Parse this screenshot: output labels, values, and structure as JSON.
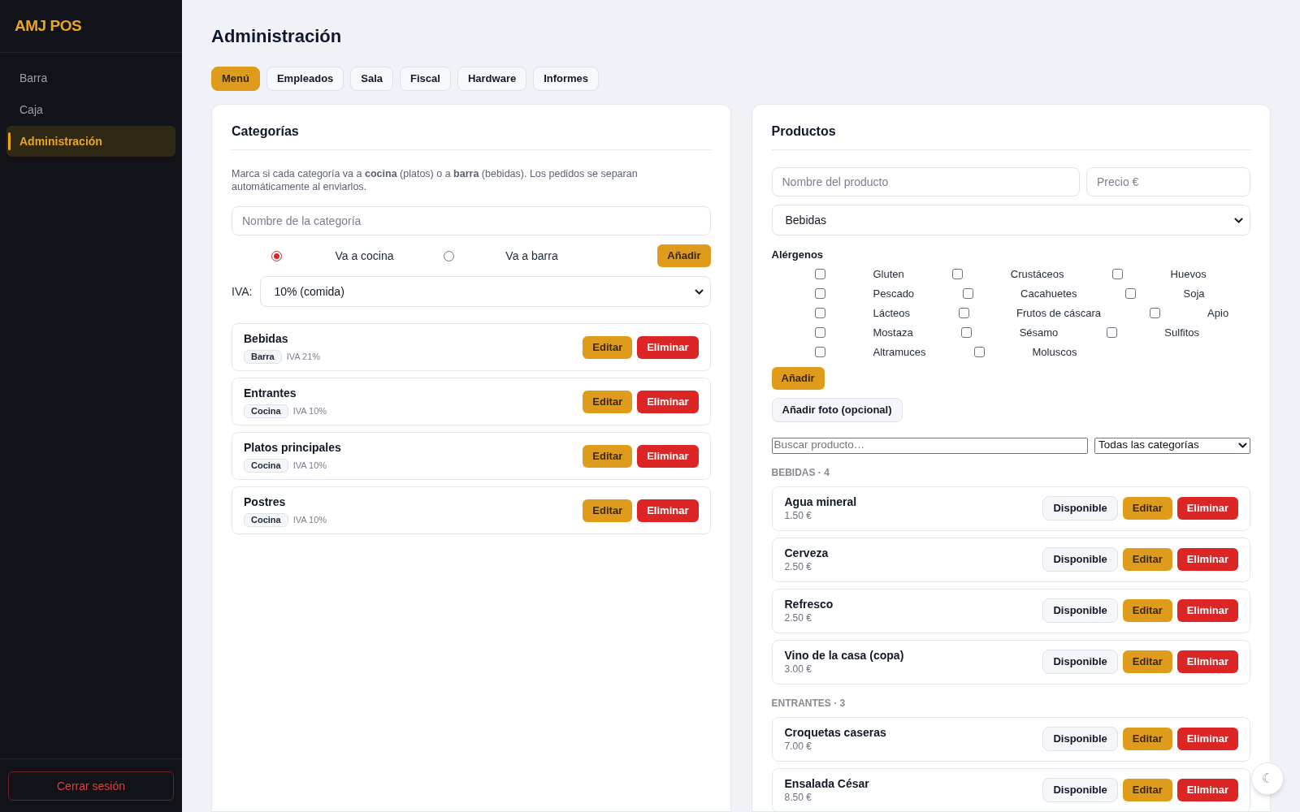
{
  "sidebar": {
    "logo": "AMJ POS",
    "items": [
      {
        "label": "Barra",
        "selected": false
      },
      {
        "label": "Caja",
        "selected": false
      },
      {
        "label": "Administración",
        "selected": true
      }
    ],
    "logout": "Cerrar sesión"
  },
  "page": {
    "title": "Administración"
  },
  "tabs": [
    {
      "label": "Menú",
      "selected": true
    },
    {
      "label": "Empleados",
      "selected": false
    },
    {
      "label": "Sala",
      "selected": false
    },
    {
      "label": "Fiscal",
      "selected": false
    },
    {
      "label": "Hardware",
      "selected": false
    },
    {
      "label": "Informes",
      "selected": false
    }
  ],
  "categories": {
    "title": "Categorías",
    "description": "Marca si cada categoría va a **cocina** (platos) o a **barra** (bebidas). Los pedidos se separan automáticamente al enviarlos.",
    "name_field": {
      "placeholder": "Nombre de la categoría"
    },
    "destinations": [
      {
        "label": "Va a cocina",
        "selected": true
      },
      {
        "label": "Va a barra",
        "selected": false
      }
    ],
    "add_button": "Añadir",
    "iva": {
      "label": "IVA:",
      "value": "10% (comida)"
    },
    "items": [
      {
        "name": "Bebidas",
        "destination": "Barra",
        "iva": "IVA 21%",
        "edit": "Editar",
        "delete": "Eliminar"
      },
      {
        "name": "Entrantes",
        "destination": "Cocina",
        "iva": "IVA 10%",
        "edit": "Editar",
        "delete": "Eliminar"
      },
      {
        "name": "Platos principales",
        "destination": "Cocina",
        "iva": "IVA 10%",
        "edit": "Editar",
        "delete": "Eliminar"
      },
      {
        "name": "Postres",
        "destination": "Cocina",
        "iva": "IVA 10%",
        "edit": "Editar",
        "delete": "Eliminar"
      }
    ]
  },
  "products": {
    "title": "Productos",
    "name_field": {
      "placeholder": "Nombre del producto"
    },
    "price_field": {
      "placeholder": "Precio €"
    },
    "category_select": {
      "value": "Bebidas"
    },
    "allergens_label": "Alérgenos",
    "allergens": [
      {
        "label": "Gluten",
        "checked": false
      },
      {
        "label": "Crustáceos",
        "checked": false
      },
      {
        "label": "Huevos",
        "checked": false
      },
      {
        "label": "Pescado",
        "checked": false
      },
      {
        "label": "Cacahuetes",
        "checked": false
      },
      {
        "label": "Soja",
        "checked": false
      },
      {
        "label": "Lácteos",
        "checked": false
      },
      {
        "label": "Frutos de cáscara",
        "checked": false
      },
      {
        "label": "Apio",
        "checked": false
      },
      {
        "label": "Mostaza",
        "checked": false
      },
      {
        "label": "Sésamo",
        "checked": false
      },
      {
        "label": "Sulfitos",
        "checked": false
      },
      {
        "label": "Altramuces",
        "checked": false
      },
      {
        "label": "Moluscos",
        "checked": false
      }
    ],
    "add_button": "Añadir",
    "photo_button": "Añadir foto (opcional)",
    "search_field": {
      "placeholder": "Buscar producto…"
    },
    "filter_select": {
      "value": "Todas las categorías"
    },
    "groups": [
      {
        "heading": "BEBIDAS · 4",
        "items": [
          {
            "name": "Agua mineral",
            "price": "1.50 €",
            "availability": "Disponible",
            "edit": "Editar",
            "delete": "Eliminar"
          },
          {
            "name": "Cerveza",
            "price": "2.50 €",
            "availability": "Disponible",
            "edit": "Editar",
            "delete": "Eliminar"
          },
          {
            "name": "Refresco",
            "price": "2.50 €",
            "availability": "Disponible",
            "edit": "Editar",
            "delete": "Eliminar"
          },
          {
            "name": "Vino de la casa (copa)",
            "price": "3.00 €",
            "availability": "Disponible",
            "edit": "Editar",
            "delete": "Eliminar"
          }
        ]
      },
      {
        "heading": "ENTRANTES · 3",
        "items": [
          {
            "name": "Croquetas caseras",
            "price": "7.00 €",
            "availability": "Disponible",
            "edit": "Editar",
            "delete": "Eliminar"
          },
          {
            "name": "Ensalada César",
            "price": "8.50 €",
            "availability": "Disponible",
            "edit": "Editar",
            "delete": "Eliminar"
          }
        ]
      }
    ]
  },
  "theme_toggle": "☾"
}
